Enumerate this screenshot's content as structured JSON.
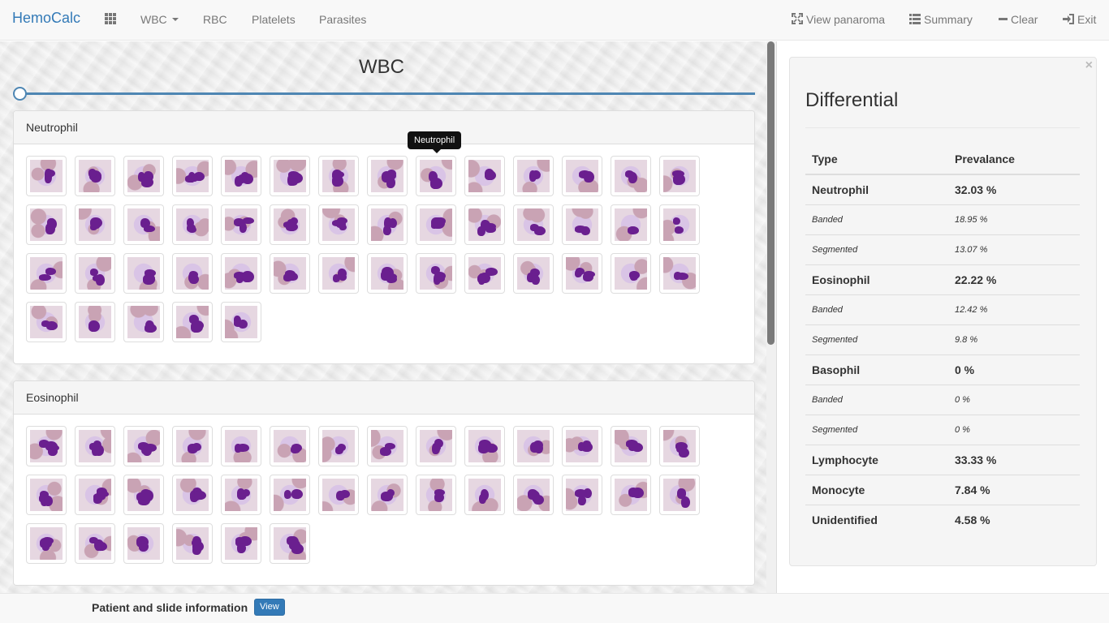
{
  "navbar": {
    "brand": "HemoCalc",
    "apps_icon": "grid-icon",
    "menu": [
      {
        "label": "WBC",
        "dropdown": true
      },
      {
        "label": "RBC"
      },
      {
        "label": "Platelets"
      },
      {
        "label": "Parasites"
      }
    ],
    "actions": [
      {
        "label": "View panaroma",
        "icon": "fullscreen-icon"
      },
      {
        "label": "Summary",
        "icon": "list-icon"
      },
      {
        "label": "Clear",
        "icon": "minus-icon"
      },
      {
        "label": "Exit",
        "icon": "logout-icon"
      }
    ]
  },
  "main": {
    "title": "WBC",
    "slider_value": 0,
    "panels": [
      {
        "heading": "Neutrophil",
        "count": 47
      },
      {
        "heading": "Eosinophil",
        "count": 34
      }
    ],
    "tooltip": "Neutrophil"
  },
  "differential": {
    "title": "Differential",
    "headers": [
      "Type",
      "Prevalance"
    ],
    "rows": [
      {
        "type": "Neutrophil",
        "value": "32.03 %",
        "level": "main"
      },
      {
        "type": "Banded",
        "value": "18.95 %",
        "level": "sub"
      },
      {
        "type": "Segmented",
        "value": "13.07 %",
        "level": "sub"
      },
      {
        "type": "Eosinophil",
        "value": "22.22 %",
        "level": "main"
      },
      {
        "type": "Banded",
        "value": "12.42 %",
        "level": "sub"
      },
      {
        "type": "Segmented",
        "value": "9.8 %",
        "level": "sub"
      },
      {
        "type": "Basophil",
        "value": "0 %",
        "level": "main"
      },
      {
        "type": "Banded",
        "value": "0 %",
        "level": "sub"
      },
      {
        "type": "Segmented",
        "value": "0 %",
        "level": "sub"
      },
      {
        "type": "Lymphocyte",
        "value": "33.33 %",
        "level": "main"
      },
      {
        "type": "Monocyte",
        "value": "7.84 %",
        "level": "main"
      },
      {
        "type": "Unidentified",
        "value": "4.58 %",
        "level": "main"
      }
    ]
  },
  "footer": {
    "label": "Patient and slide information",
    "button": "View"
  },
  "colors": {
    "accent": "#337ab7",
    "slider": "#4e86b3",
    "stain_nucleus": "#6a1f8f",
    "stain_cytoplasm": "#d9c4e6",
    "rbc": "#c9a3b4"
  }
}
